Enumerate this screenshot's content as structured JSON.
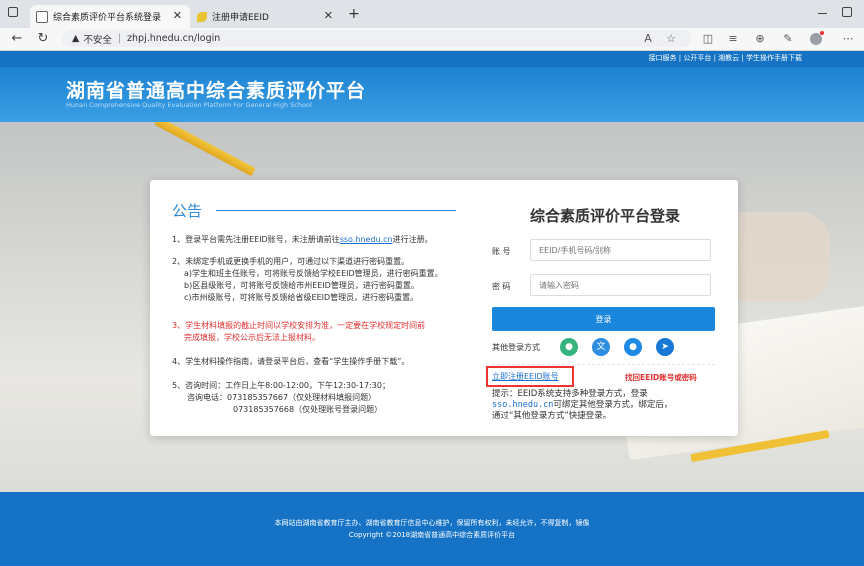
{
  "browser": {
    "tabs": [
      {
        "title": "综合素质评价平台系统登录",
        "active": true
      },
      {
        "title": "注册申请EEID",
        "active": false
      }
    ],
    "security_label": "不安全",
    "url": "zhpj.hnedu.cn/login",
    "new_tab": "+"
  },
  "header": {
    "top_links": "接口服务 | 公开平台 | 湘教云 | 学生操作手册下载",
    "title": "湖南省普通高中综合素质评价平台",
    "subtitle": "Hunan Comprehensive Quality Evaluation Platform For General High School"
  },
  "announcement": {
    "title": "公告",
    "item1_prefix": "1、登录平台需先注册EEID账号，未注册请前往",
    "item1_link": "sso.hnedu.cn",
    "item1_suffix": "进行注册。",
    "item2_line1": "2、未绑定手机或更换手机的用户，可通过以下渠道进行密码重置。",
    "item2_line2": "a)学生和班主任账号，可将账号反馈给学校EEID管理员，进行密码重置。",
    "item2_line3": "b)区县级账号，可将账号反馈给市州EEID管理员，进行密码重置。",
    "item2_line4": "c)市州级账号，可将账号反馈给省级EEID管理员，进行密码重置。",
    "item3_line1": "3、学生材料填报的截止时间以学校安排为准，一定要在学校规定时间前",
    "item3_line2": "完成填报，学校公示后无法上报材料。",
    "item4": "4、学生材料操作指南，请登录平台后，查看“学生操作手册下载”。",
    "item5_line1": "5、咨询时间：工作日上午8:00-12:00，下午12:30-17:30；",
    "item5_line2": "咨询电话：073185357667（仅处理材料填报问题）",
    "item5_line3": "073185357668（仅处理账号登录问题）"
  },
  "login": {
    "title": "综合素质评价平台登录",
    "account_label": "账 号",
    "account_placeholder": "EEID/手机号码/别称",
    "password_label": "密 码",
    "password_placeholder": "请输入密码",
    "login_button": "登录",
    "other_methods": "其他登录方式",
    "social_colors": [
      "#36b37e",
      "#2f8ee0",
      "#1f8ae6",
      "#1978d6"
    ],
    "register_link": "立即注册EEID账号",
    "find_link": "找回EEID账号或密码",
    "tip_line1": "提示：EEID系统支持多种登录方式，登录",
    "tip_line2_mono": "sso.hnedu.cn",
    "tip_line2_rest": "可绑定其他登录方式，绑定后，",
    "tip_line3": "通过“其他登录方式”快捷登录。"
  },
  "footer": {
    "line1": "本网站由湖南省教育厅主办、湖南省教育厅信息中心维护，保留所有权利，未经允许，不得复制，镜像",
    "line2": "Copyright ©2018湖南省普通高中综合素质评价平台"
  }
}
